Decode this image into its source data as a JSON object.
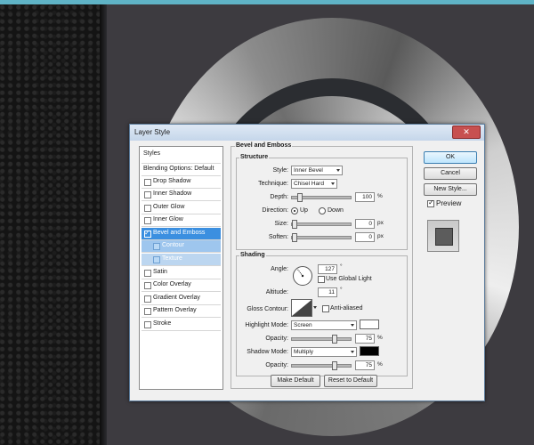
{
  "dialog": {
    "title": "Layer Style",
    "close_icon": "close-icon"
  },
  "styles_list": {
    "header": "Styles",
    "blending": "Blending Options: Default",
    "items": [
      {
        "label": "Drop Shadow",
        "checked": false
      },
      {
        "label": "Inner Shadow",
        "checked": false
      },
      {
        "label": "Outer Glow",
        "checked": false
      },
      {
        "label": "Inner Glow",
        "checked": false
      },
      {
        "label": "Bevel and Emboss",
        "checked": true
      },
      {
        "label": "Contour",
        "checked": false
      },
      {
        "label": "Texture",
        "checked": false
      },
      {
        "label": "Satin",
        "checked": false
      },
      {
        "label": "Color Overlay",
        "checked": false
      },
      {
        "label": "Gradient Overlay",
        "checked": false
      },
      {
        "label": "Pattern Overlay",
        "checked": false
      },
      {
        "label": "Stroke",
        "checked": false
      }
    ]
  },
  "bevel": {
    "group_title": "Bevel and Emboss",
    "structure": {
      "title": "Structure",
      "style_label": "Style:",
      "style_value": "Inner Bevel",
      "technique_label": "Technique:",
      "technique_value": "Chisel Hard",
      "depth_label": "Depth:",
      "depth_value": "100",
      "depth_unit": "%",
      "depth_level": 0.1,
      "direction_label": "Direction:",
      "direction_up": "Up",
      "direction_down": "Down",
      "direction_selected": "Up",
      "size_label": "Size:",
      "size_value": "0",
      "size_unit": "px",
      "size_level": 0.0,
      "soften_label": "Soften:",
      "soften_value": "0",
      "soften_unit": "px",
      "soften_level": 0.0
    },
    "shading": {
      "title": "Shading",
      "angle_label": "Angle:",
      "angle_value": "127",
      "angle_unit": "°",
      "global_light_label": "Use Global Light",
      "global_light_checked": false,
      "altitude_label": "Altitude:",
      "altitude_value": "11",
      "altitude_unit": "°",
      "gloss_label": "Gloss Contour:",
      "anti_aliased_label": "Anti-aliased",
      "anti_aliased_checked": false,
      "highlight_mode_label": "Highlight Mode:",
      "highlight_mode_value": "Screen",
      "highlight_color": "#ffffff",
      "highlight_opacity_label": "Opacity:",
      "highlight_opacity_value": "75",
      "highlight_opacity_unit": "%",
      "highlight_opacity_level": 0.75,
      "shadow_mode_label": "Shadow Mode:",
      "shadow_mode_value": "Multiply",
      "shadow_color": "#000000",
      "shadow_opacity_label": "Opacity:",
      "shadow_opacity_value": "75",
      "shadow_opacity_unit": "%",
      "shadow_opacity_level": 0.75
    },
    "make_default": "Make Default",
    "reset_default": "Reset to Default"
  },
  "side_buttons": {
    "ok": "OK",
    "cancel": "Cancel",
    "new_style": "New Style...",
    "preview_label": "Preview",
    "preview_checked": true
  },
  "colors": {
    "selection": "#3b8fe0",
    "close_button": "#c75050"
  }
}
